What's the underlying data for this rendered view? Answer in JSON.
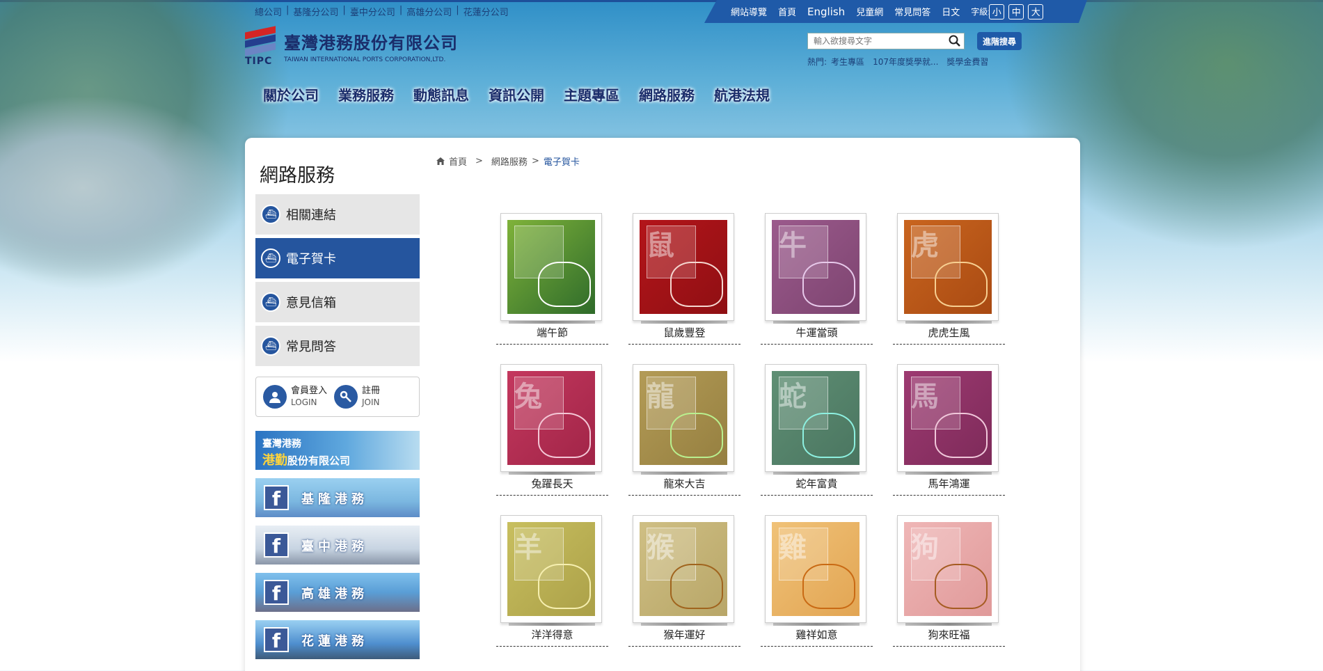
{
  "branches": [
    "總公司",
    "基隆分公司",
    "臺中分公司",
    "高雄分公司",
    "花蓮分公司"
  ],
  "branch_sep": "|",
  "util": {
    "sitemap": "網站導覽",
    "home": "首頁",
    "english": "English",
    "kids": "兒童網",
    "faq": "常見問答",
    "japanese": "日文",
    "font_label": "字級:",
    "font_small": "小",
    "font_medium": "中",
    "font_large": "大"
  },
  "logo": {
    "mark_text": "TIPC",
    "name_cn": "臺灣港務股份有限公司",
    "name_en": "TAIWAN INTERNATIONAL PORTS CORPORATION,LTD."
  },
  "search": {
    "placeholder": "輸入欲搜尋文字",
    "advanced_label": "進階搜尋",
    "hot_label": "熱門:",
    "hot_items": [
      "考生專區",
      "107年度獎學就...",
      "獎學金費習"
    ]
  },
  "main_nav": [
    "關於公司",
    "業務服務",
    "動態訊息",
    "資訊公開",
    "主題專區",
    "網路服務",
    "航港法規"
  ],
  "sidebar": {
    "title": "網路服務",
    "items": [
      {
        "label": "相關連結",
        "active": false
      },
      {
        "label": "電子賀卡",
        "active": true
      },
      {
        "label": "意見信箱",
        "active": false
      },
      {
        "label": "常見問答",
        "active": false
      }
    ]
  },
  "member": {
    "login_cn": "會員登入",
    "login_en": "LOGIN",
    "join_cn": "註冊",
    "join_en": "JOIN"
  },
  "banners": {
    "b0_line1": "臺灣港務",
    "b0_highlight": "港勤",
    "b0_line2": "股份有限公司",
    "fb_letter": "f",
    "keelung": "基隆港務",
    "taichung": "臺中港務",
    "kaohsiung": "高雄港務",
    "hualien": "花蓮港務"
  },
  "breadcrumb": {
    "home": "首頁",
    "sep": ">",
    "level1": "網路服務",
    "current": "電子賀卡"
  },
  "cards": [
    {
      "caption": "端午節",
      "glyph": "",
      "color": "#7fb23a",
      "color2": "#2e6b2a",
      "line": "#ffffff"
    },
    {
      "caption": "鼠歲豐登",
      "glyph": "鼠",
      "color": "#b3151a",
      "color2": "#8f0f13",
      "line": "#f5d7d0"
    },
    {
      "caption": "牛運當頭",
      "glyph": "牛",
      "color": "#9b5a8c",
      "color2": "#7d4470",
      "line": "#e7c9ea"
    },
    {
      "caption": "虎虎生風",
      "glyph": "虎",
      "color": "#c9651f",
      "color2": "#a94a12",
      "line": "#f7cf91"
    },
    {
      "caption": "兔躍長天",
      "glyph": "兔",
      "color": "#c4385e",
      "color2": "#a02447",
      "line": "#f4c7d6"
    },
    {
      "caption": "龍來大吉",
      "glyph": "龍",
      "color": "#b39b56",
      "color2": "#957f40",
      "line": "#b9f08f"
    },
    {
      "caption": "蛇年富貴",
      "glyph": "蛇",
      "color": "#5f8f74",
      "color2": "#4a7560",
      "line": "#8df0e0"
    },
    {
      "caption": "馬年鴻運",
      "glyph": "馬",
      "color": "#9d3a71",
      "color2": "#7d2a59",
      "line": "#f0c7da"
    },
    {
      "caption": "洋洋得意",
      "glyph": "羊",
      "color": "#c8bf5f",
      "color2": "#aba048",
      "line": "#f6efb0"
    },
    {
      "caption": "猴年運好",
      "glyph": "猴",
      "color": "#cfbf84",
      "color2": "#b8a668",
      "line": "#a0641e"
    },
    {
      "caption": "雞祥如意",
      "glyph": "雞",
      "color": "#f0c278",
      "color2": "#e2a553",
      "line": "#c96a14"
    },
    {
      "caption": "狗來旺福",
      "glyph": "狗",
      "color": "#efb6b6",
      "color2": "#e09a9a",
      "line": "#a55c22"
    }
  ]
}
